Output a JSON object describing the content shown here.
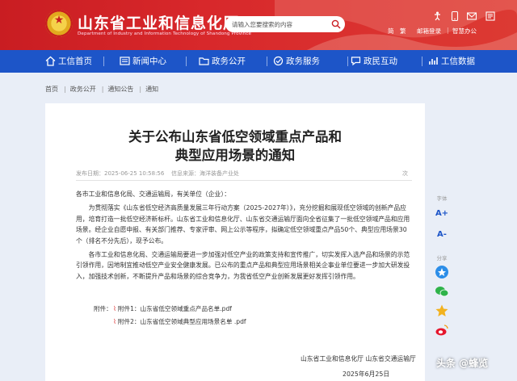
{
  "header": {
    "site_title": "山东省工业和信息化厅",
    "site_subtitle": "Department of Industry and Information Technology of Shandong Province",
    "search_placeholder": "请输入您要搜索的内容",
    "tools": {
      "simplified": "简",
      "traditional": "繁",
      "email_login": "邮箱登录",
      "elder_mode": "智慧办公"
    }
  },
  "nav": {
    "items": [
      {
        "label": "工信首页",
        "icon": "home-icon"
      },
      {
        "label": "新闻中心",
        "icon": "news-icon"
      },
      {
        "label": "政务公开",
        "icon": "folder-icon"
      },
      {
        "label": "政务服务",
        "icon": "service-icon"
      },
      {
        "label": "政民互动",
        "icon": "interaction-icon"
      },
      {
        "label": "工信数据",
        "icon": "data-icon"
      }
    ]
  },
  "breadcrumb": [
    "首页",
    "政务公开",
    "通知公告",
    "通知"
  ],
  "article": {
    "title_line1": "关于公布山东省低空领域重点产品和",
    "title_line2": "典型应用场景的通知",
    "publish_date": "发布日期：2025-06-25 10:58:56",
    "source": "信息来源：海洋装备产业处",
    "views": "次",
    "salutation": "各市工业和信息化局、交通运输局，有关单位（企业）：",
    "para1": "为贯彻落实《山东省低空经济高质量发展三年行动方案（2025-2027年）》，充分挖掘和展现低空领域的创新产品应用，培育打造一批低空经济新标杆。山东省工业和信息化厅、山东省交通运输厅面向全省征集了一批低空领域产品和应用场景。经企业自愿申报、有关部门推荐、专家评审、网上公示等程序，拟确定低空领域重点产品50个、典型应用场景30个（排名不分先后），现予公布。",
    "para2": "各市工业和信息化局、交通运输局要进一步加强对低空产业的政策支持和宣传推广，切实发挥入选产品和场景的示范引领作用，因地制宜推动低空产业安全健康发展。已公布的重点产品和典型应用场景相关企事业单位要进一步加大研发投入，加强技术创新，不断提升产品和场景的综合竞争力，为我省低空产业创新发展更好发挥引领作用。",
    "attach_label": "附件：",
    "attachments": [
      "附件1：山东省低空领域重点产品名单.pdf",
      "附件2：山东省低空领域典型应用场景名单 .pdf"
    ],
    "signature": "山东省工业和信息化厅  山东省交通运输厅",
    "date": "2025年6月25日"
  },
  "side_tools": {
    "font_label": "字体",
    "font_increase": "A+",
    "font_decrease": "A-",
    "share_label": "分享"
  },
  "watermark": "头条 @蜂览",
  "colors": {
    "header_red": "#d8282b",
    "nav_blue": "#1d55c8",
    "background": "#e9eef7"
  }
}
